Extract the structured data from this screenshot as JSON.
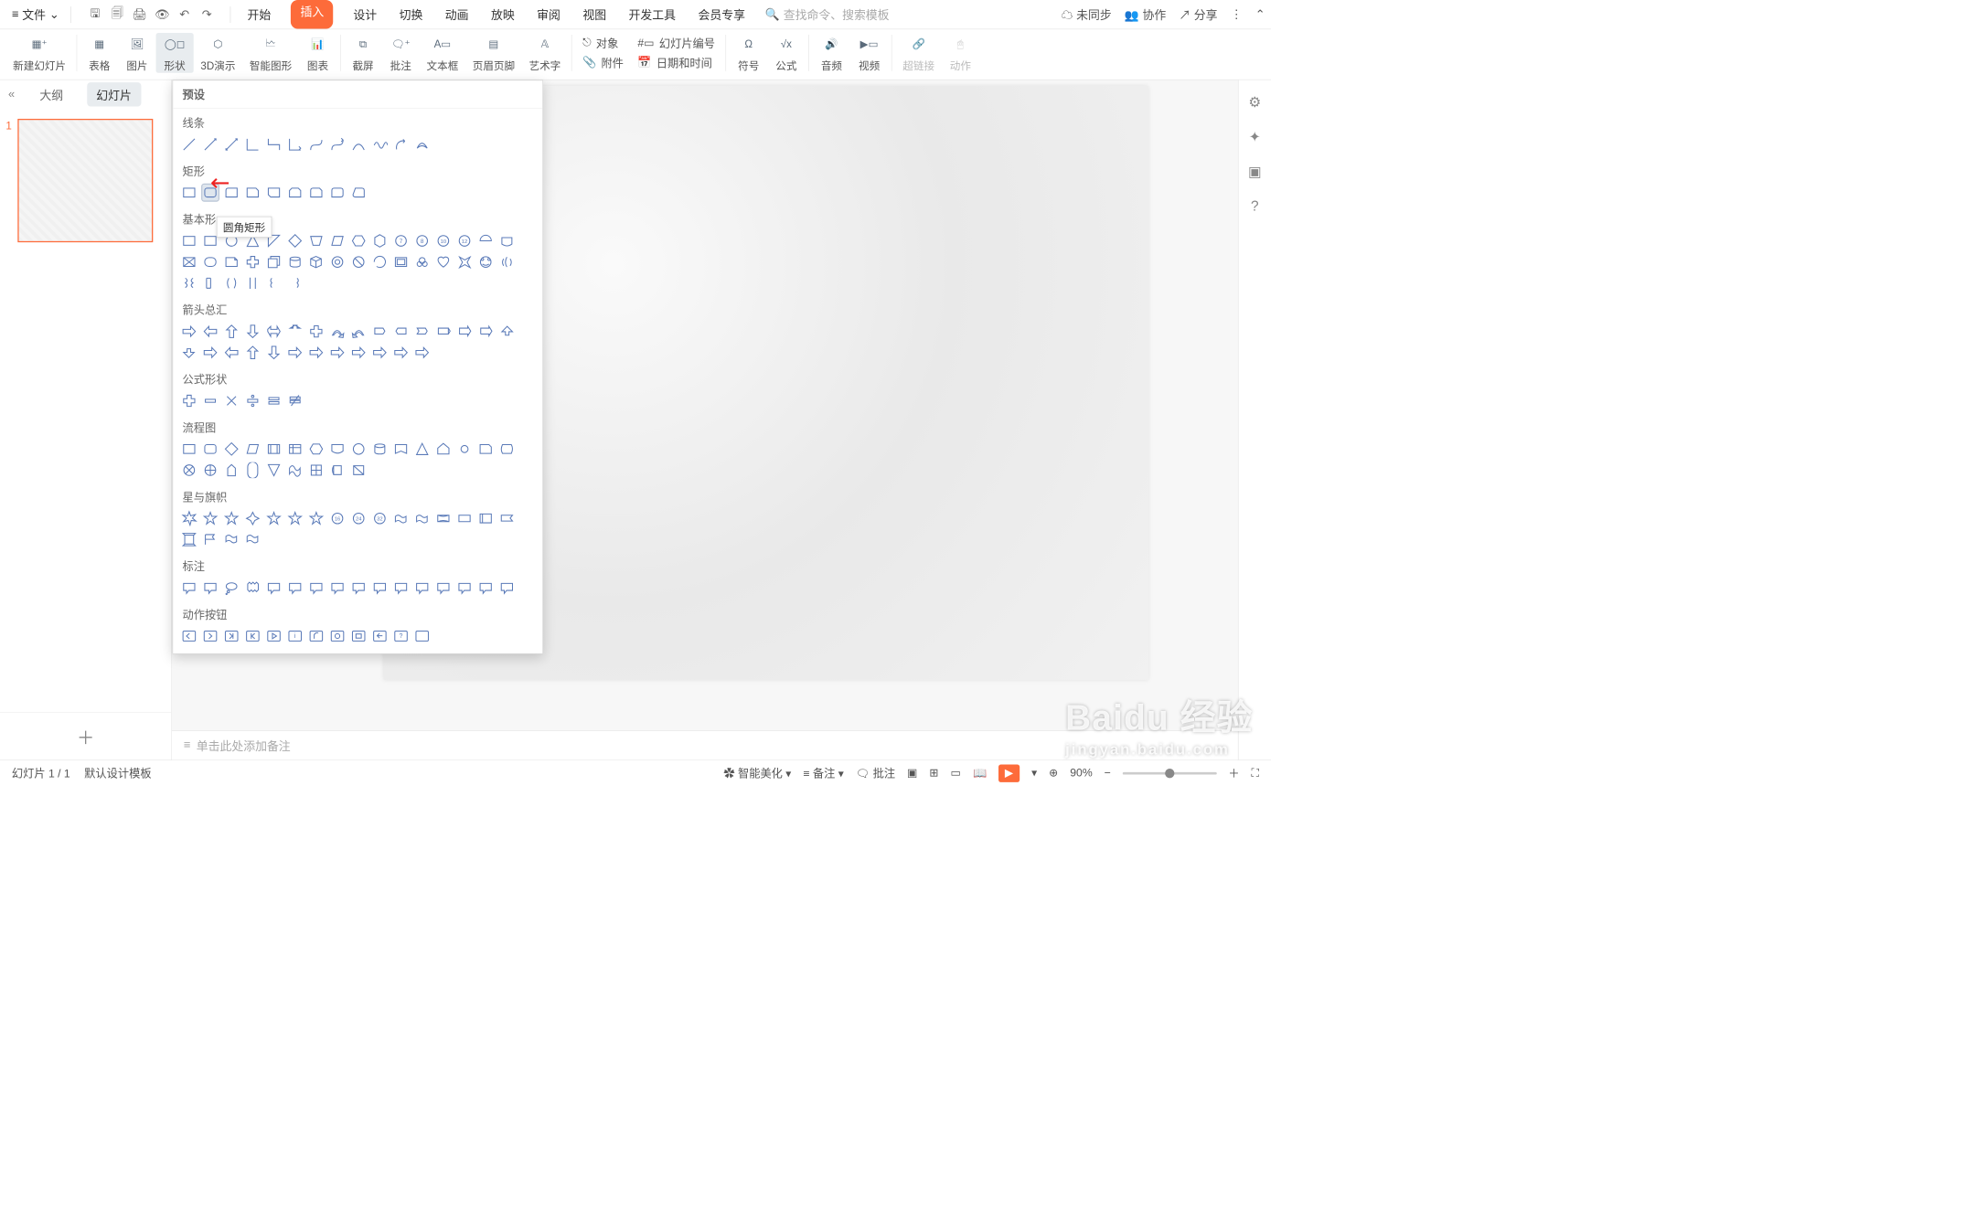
{
  "topbar": {
    "file": "文件",
    "tabs": [
      "开始",
      "插入",
      "设计",
      "切换",
      "动画",
      "放映",
      "审阅",
      "视图",
      "开发工具",
      "会员专享"
    ],
    "active_tab_index": 1,
    "search_placeholder": "查找命令、搜索模板",
    "sync": "未同步",
    "collab": "协作",
    "share": "分享"
  },
  "ribbon": {
    "new_slide": "新建幻灯片",
    "table": "表格",
    "picture": "图片",
    "shape": "形状",
    "threeD": "3D演示",
    "smartart": "智能图形",
    "chart": "图表",
    "screenshot": "截屏",
    "comment_mark": "批注",
    "textbox": "文本框",
    "header_footer": "页眉页脚",
    "wordart": "艺术字",
    "object": "对象",
    "attachment": "附件",
    "slide_number": "幻灯片编号",
    "date_time": "日期和时间",
    "symbol": "符号",
    "equation": "公式",
    "audio": "音频",
    "video": "视频",
    "hyperlink": "超链接",
    "action": "动作"
  },
  "left_panel": {
    "outline": "大纲",
    "slides": "幻灯片",
    "thumb_number": "1"
  },
  "notes": {
    "placeholder": "单击此处添加备注"
  },
  "statusbar": {
    "slide_counter": "幻灯片 1 / 1",
    "template": "默认设计模板",
    "smart_beautify": "智能美化",
    "notes_btn": "备注",
    "comment_btn": "批注",
    "zoom": "90%"
  },
  "shape_dropdown": {
    "presets": "预设",
    "lines": "线条",
    "rects": "矩形",
    "basic": "基本形",
    "arrows": "箭头总汇",
    "equations": "公式形状",
    "flowchart": "流程图",
    "stars": "星与旗帜",
    "callouts": "标注",
    "actions": "动作按钮",
    "tooltip": "圆角矩形"
  },
  "watermark": {
    "brand": "Baidu 经验",
    "url": "jingyan.baidu.com"
  }
}
